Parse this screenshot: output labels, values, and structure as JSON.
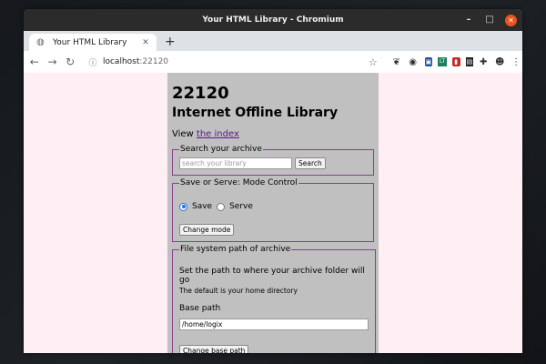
{
  "window": {
    "title": "Your HTML Library - Chromium",
    "controls": {
      "minimize": "–",
      "maximize": "□",
      "close": "✕"
    }
  },
  "tab": {
    "title": "Your HTML Library",
    "close": "✕",
    "new_tab": "+"
  },
  "address_bar": {
    "host": "localhost",
    "port": ":22120"
  },
  "page": {
    "number": "22120",
    "title": "Internet Offline Library",
    "view_prefix": "View ",
    "view_link": "the index",
    "search": {
      "legend": "Search your archive",
      "placeholder": "search your library",
      "button": "Search"
    },
    "mode": {
      "legend": "Save or Serve: Mode Control",
      "option_save": "Save",
      "option_serve": "Serve",
      "selected": "Save",
      "button": "Change mode"
    },
    "fs": {
      "legend": "File system path of archive",
      "line1": "Set the path to where your archive folder will go",
      "line2": "The default is your home directory",
      "base_label": "Base path",
      "base_value": "/home/logix",
      "button": "Change base path"
    }
  },
  "colors": {
    "page_bg": "#ffeef4",
    "panel_bg": "#c0c0c0",
    "fieldset_border": "#8a3f8a",
    "accent": "#e95420"
  }
}
